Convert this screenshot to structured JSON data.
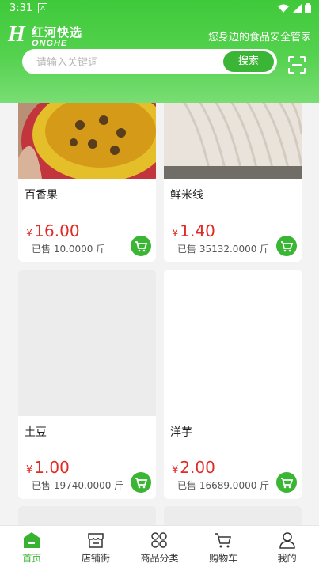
{
  "status_bar": {
    "time": "3:31",
    "notification": "A"
  },
  "header": {
    "logo_letter": "H",
    "logo_cn": "红河快选",
    "logo_en": "ONGHE",
    "slogan": "您身边的食品安全管家"
  },
  "search": {
    "placeholder": "请输入关键词",
    "button_label": "搜索"
  },
  "products": [
    {
      "name": "百香果",
      "currency": "¥",
      "price": "16.00",
      "sold": "已售 10.0000 斤"
    },
    {
      "name": "鲜米线",
      "currency": "¥",
      "price": "1.40",
      "sold": "已售 35132.0000 斤"
    },
    {
      "name": "土豆",
      "currency": "¥",
      "price": "1.00",
      "sold": "已售 19740.0000 斤"
    },
    {
      "name": "洋芋",
      "currency": "¥",
      "price": "2.00",
      "sold": "已售 16689.0000 斤"
    }
  ],
  "nav": [
    {
      "label": "首页",
      "icon": "home-icon",
      "active": true
    },
    {
      "label": "店铺街",
      "icon": "store-icon"
    },
    {
      "label": "商品分类",
      "icon": "category-icon"
    },
    {
      "label": "购物车",
      "icon": "cart-icon"
    },
    {
      "label": "我的",
      "icon": "user-icon"
    }
  ],
  "colors": {
    "brand_green": "#3bb535",
    "price_red": "#e02b27",
    "background": "#f3f3f3"
  }
}
